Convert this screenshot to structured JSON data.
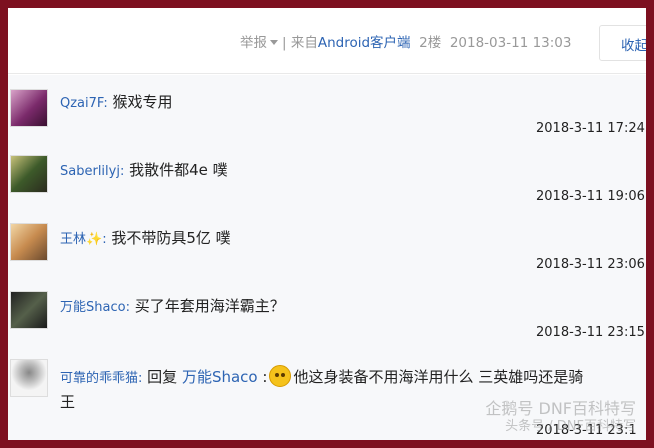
{
  "post_meta": {
    "report_label": "举报",
    "source_prefix": "| 来自",
    "source_app": "Android客户端",
    "floor": "2楼",
    "datetime": "2018-03-11 13:03"
  },
  "collapse_label": "收起",
  "replies": [
    {
      "username": "Qzai7F",
      "colon": ":",
      "content": " 猴戏专用",
      "time": "2018-3-11 17:24"
    },
    {
      "username": "Saberlilyj",
      "colon": ":",
      "content": " 我散件都4e 噗",
      "time": "2018-3-11 19:06"
    },
    {
      "username": "王林",
      "badge": "✨",
      "colon": ":",
      "content": " 我不带防具5亿 噗",
      "time": "2018-3-11 23:06"
    },
    {
      "username": "万能Shaco",
      "colon": ":",
      "content": " 买了年套用海洋霸主？",
      "time": "2018-3-11 23:15"
    },
    {
      "username": "可靠的乖乖猫",
      "colon": ":",
      "reply_prefix": " 回复 ",
      "reply_to": "万能Shaco",
      "reply_colon": " :",
      "content": "他这身装备不用海洋用什么 三英雄吗还是骑",
      "content_cont": "王",
      "time": "2018-3-11 23:1"
    }
  ],
  "watermark": {
    "line1": "企鹅号 DNF百科特写",
    "line2": "头条号 / DNF百科特写"
  }
}
